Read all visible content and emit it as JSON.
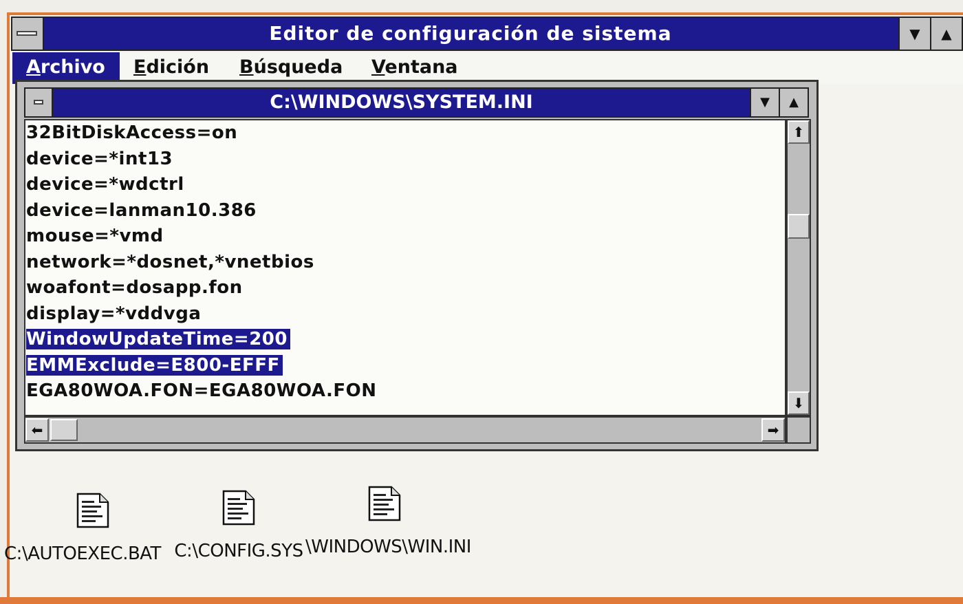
{
  "app": {
    "title": "Editor de configuración de sistema"
  },
  "menubar": {
    "items": [
      {
        "label_u": "A",
        "label_rest": "rchivo",
        "active": true
      },
      {
        "label_u": "E",
        "label_rest": "dición",
        "active": false
      },
      {
        "label_u": "B",
        "label_rest": "úsqueda",
        "active": false
      },
      {
        "label_u": "V",
        "label_rest": "entana",
        "active": false
      }
    ]
  },
  "child_window": {
    "title": "C:\\WINDOWS\\SYSTEM.INI",
    "lines": [
      {
        "text": "32BitDiskAccess=on",
        "selected": false
      },
      {
        "text": "device=*int13",
        "selected": false
      },
      {
        "text": "device=*wdctrl",
        "selected": false
      },
      {
        "text": "device=lanman10.386",
        "selected": false
      },
      {
        "text": "mouse=*vmd",
        "selected": false
      },
      {
        "text": "network=*dosnet,*vnetbios",
        "selected": false
      },
      {
        "text": "woafont=dosapp.fon",
        "selected": false
      },
      {
        "text": "display=*vddvga",
        "selected": false
      },
      {
        "text": "WindowUpdateTime=200",
        "selected": true
      },
      {
        "text": "EMMExclude=E800-EFFF",
        "selected": true
      },
      {
        "text": "EGA80WOA.FON=EGA80WOA.FON",
        "selected": false
      }
    ]
  },
  "icons": [
    {
      "label": "C:\\AUTOEXEC.BAT",
      "icon": "document-icon"
    },
    {
      "label": "C:\\CONFIG.SYS",
      "icon": "document-icon"
    },
    {
      "label": "\\WINDOWS\\WIN.INI",
      "icon": "document-icon"
    }
  ],
  "colors": {
    "titlebar": "#1d1a8f",
    "selection": "#1d1a8f",
    "scrollbar": "#bdbdbd"
  }
}
